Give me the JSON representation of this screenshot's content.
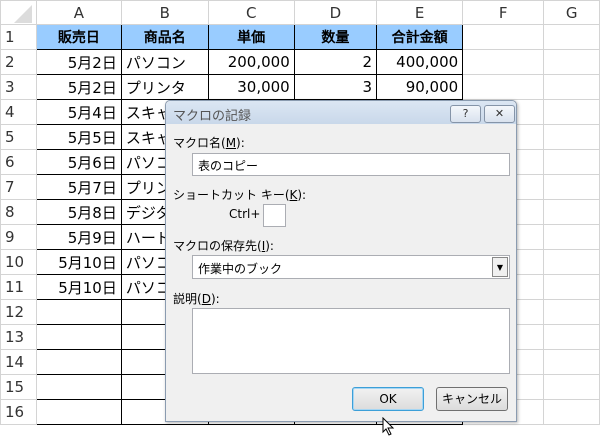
{
  "columns": [
    "A",
    "B",
    "C",
    "D",
    "E",
    "F",
    "G"
  ],
  "rows": [
    "1",
    "2",
    "3",
    "4",
    "5",
    "6",
    "7",
    "8",
    "9",
    "10",
    "11",
    "12",
    "13",
    "14",
    "15",
    "16"
  ],
  "header": [
    "販売日",
    "商品名",
    "単価",
    "数量",
    "合計金額"
  ],
  "data": [
    [
      "5月2日",
      "パソコン",
      "200,000",
      "2",
      "400,000"
    ],
    [
      "5月2日",
      "プリンタ",
      "30,000",
      "3",
      "90,000"
    ],
    [
      "5月4日",
      "スキャ",
      "",
      "",
      ""
    ],
    [
      "5月5日",
      "スキャ",
      "",
      "",
      ""
    ],
    [
      "5月6日",
      "パソコ",
      "",
      "",
      ""
    ],
    [
      "5月7日",
      "プリン",
      "",
      "",
      ""
    ],
    [
      "5月8日",
      "デジタ",
      "",
      "",
      ""
    ],
    [
      "5月9日",
      "ハード",
      "",
      "",
      ""
    ],
    [
      "5月10日",
      "パソコ",
      "",
      "",
      ""
    ],
    [
      "5月10日",
      "パソコ",
      "",
      "",
      ""
    ]
  ],
  "header_color": "#99ccff",
  "dialog": {
    "title": "マクロの記録",
    "help": "?",
    "close": "✕",
    "name_label": "マクロ名(",
    "name_key": "M",
    "name_value": "表のコピー",
    "shortcut_label": "ショートカット キー(",
    "shortcut_key": "K",
    "ctrl": "Ctrl+",
    "shortcut_value": "",
    "store_label": "マクロの保存先(",
    "store_key": "I",
    "store_value": "作業中のブック",
    "desc_label": "説明(",
    "desc_key": "D",
    "desc_value": "",
    "label_end": "):",
    "ok": "OK",
    "cancel": "キャンセル"
  }
}
